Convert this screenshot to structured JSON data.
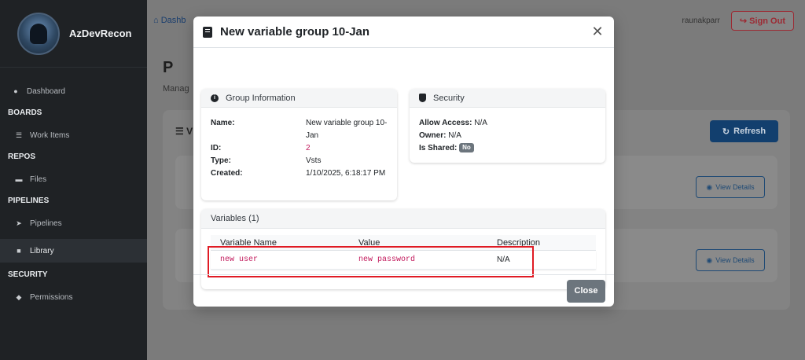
{
  "sidebar": {
    "brand": "AzDevRecon",
    "dashboard": "Dashboard",
    "boards_head": "BOARDS",
    "work_items": "Work Items",
    "repos_head": "REPOS",
    "files": "Files",
    "pipelines_head": "PIPELINES",
    "pipelines": "Pipelines",
    "library": "Library",
    "security_head": "SECURITY",
    "permissions": "Permissions"
  },
  "topbar": {
    "breadcrumb": "Dashb",
    "user": "raunakparr",
    "signout": "Sign Out"
  },
  "background": {
    "page_title": "P",
    "page_subtitle": "Manag",
    "list_label": "☰ V",
    "refresh_label": "Refresh",
    "view_details_label": "View Details"
  },
  "modal": {
    "title": "New variable group 10-Jan",
    "group_info_title": "Group Information",
    "name_label": "Name:",
    "name_value": "New variable group 10-Jan",
    "id_label": "ID:",
    "id_value": "2",
    "type_label": "Type:",
    "type_value": "Vsts",
    "created_label": "Created:",
    "created_value": "1/10/2025, 6:18:17 PM",
    "security_title": "Security",
    "allow_access_label": "Allow Access:",
    "allow_access_value": "N/A",
    "owner_label": "Owner:",
    "owner_value": "N/A",
    "is_shared_label": "Is Shared:",
    "is_shared_value": "No",
    "variables_title": "Variables (1)",
    "columns": [
      "Variable Name",
      "Value",
      "Description"
    ],
    "variables": [
      {
        "name": "new user",
        "value": "new password",
        "description": "N/A"
      }
    ],
    "close_label": "Close"
  },
  "colors": {
    "accent": "#123f6e",
    "signout": "#9c2a33",
    "highlight": "#e01b24",
    "code": "#c2185b"
  }
}
